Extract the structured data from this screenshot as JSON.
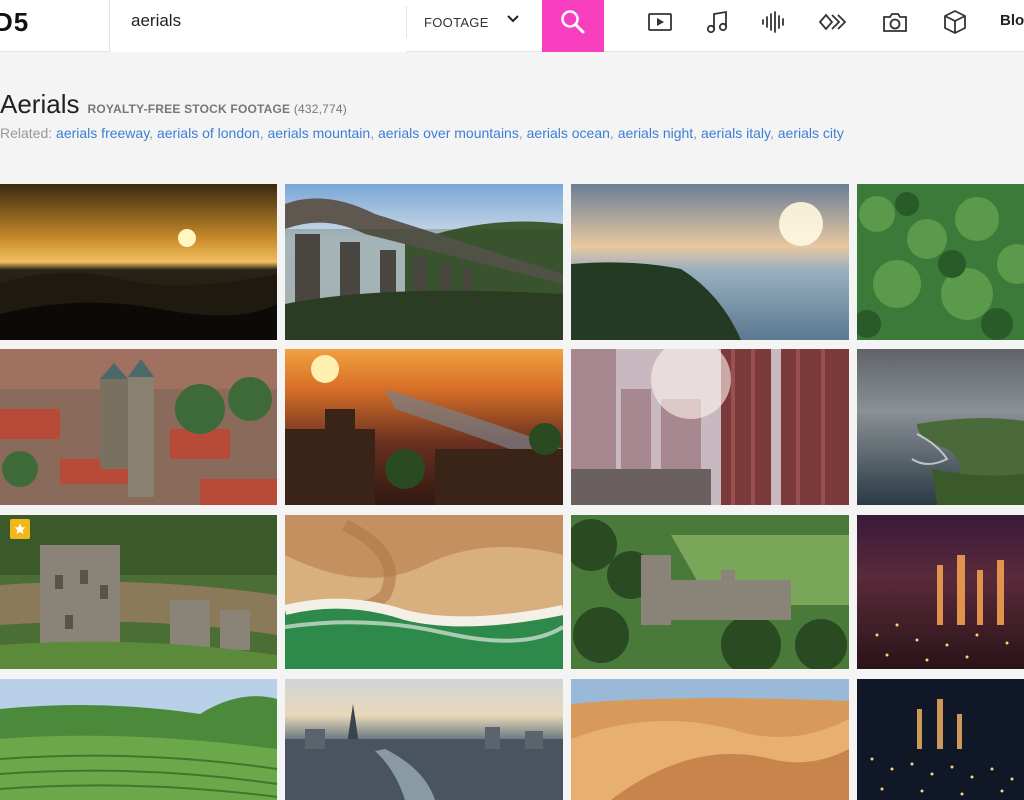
{
  "header": {
    "logo_text": "D5",
    "search": {
      "value": "aerials",
      "placeholder": ""
    },
    "media_type": "FOOTAGE",
    "type_icons": [
      "video-icon",
      "music-icon",
      "sound-effects-icon",
      "motion-graphics-icon",
      "photo-icon",
      "3d-model-icon"
    ],
    "blog_label": "Blog"
  },
  "page": {
    "title": "Aerials",
    "subtitle": "ROYALTY-FREE STOCK FOOTAGE",
    "count": "(432,774)",
    "related_label": "Related:",
    "related": [
      "aerials freeway",
      "aerials of london",
      "aerials mountain",
      "aerials over mountains",
      "aerials ocean",
      "aerials night",
      "aerials italy",
      "aerials city"
    ]
  },
  "colors": {
    "accent": "#f83fbf",
    "link": "#3b7fd6",
    "badge": "#f0b81a"
  },
  "thumbnails": [
    "Sunset over rocky coastline",
    "Stone railway viaduct in valley",
    "Sun rising over sea cliffs",
    "Dense green forest canopy",
    "Old town with cathedral towers",
    "City sunset with river",
    "Glass skyscrapers with sun flare",
    "Coastline with misty cliffs",
    "Castle ruins on green hill",
    "Waves on sandy beach from above",
    "Gothic college in parkland",
    "City lights at night",
    "Green terraced hills",
    "London skyline with Thames bridges",
    "Desert sand dunes",
    "Night city aerial"
  ]
}
